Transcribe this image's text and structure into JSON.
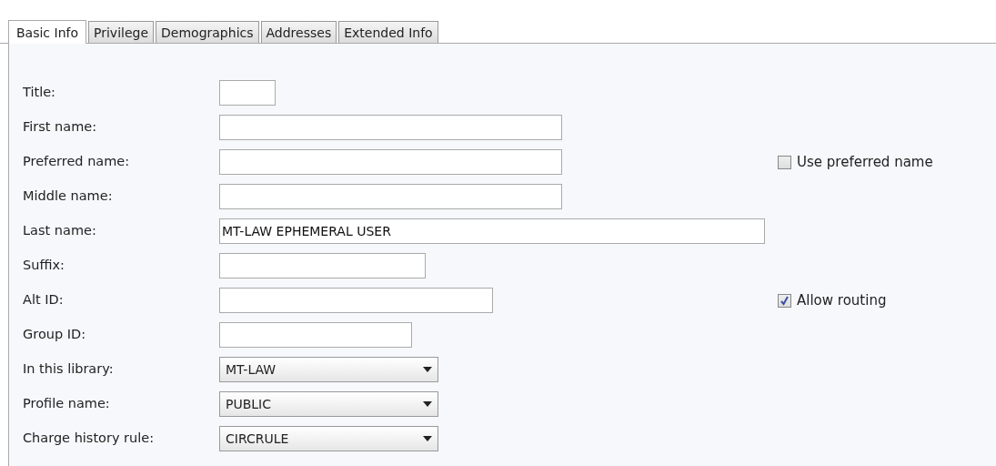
{
  "tabs": [
    {
      "label": "Basic Info",
      "selected": true
    },
    {
      "label": "Privilege",
      "selected": false
    },
    {
      "label": "Demographics",
      "selected": false
    },
    {
      "label": "Addresses",
      "selected": false
    },
    {
      "label": "Extended Info",
      "selected": false
    }
  ],
  "fields": [
    {
      "label": "Title:",
      "kind": "text"
    },
    {
      "label": "First name:",
      "kind": "text"
    },
    {
      "label": "Preferred name:",
      "kind": "text",
      "option": {
        "label": "Use preferred name",
        "checked": false
      }
    },
    {
      "label": "Middle name:",
      "kind": "text"
    },
    {
      "label": "Last name:",
      "kind": "text",
      "value": "MT-LAW EPHEMERAL USER"
    },
    {
      "label": "Suffix:",
      "kind": "text"
    },
    {
      "label": "Alt ID:",
      "kind": "text",
      "option": {
        "label": "Allow routing",
        "checked": true
      }
    },
    {
      "label": "Group ID:",
      "kind": "text"
    },
    {
      "label": "In this library:",
      "kind": "select",
      "value": "MT-LAW"
    },
    {
      "label": "Profile name:",
      "kind": "select",
      "value": "PUBLIC"
    },
    {
      "label": "Charge history rule:",
      "kind": "select",
      "value": "CIRCRULE"
    }
  ]
}
